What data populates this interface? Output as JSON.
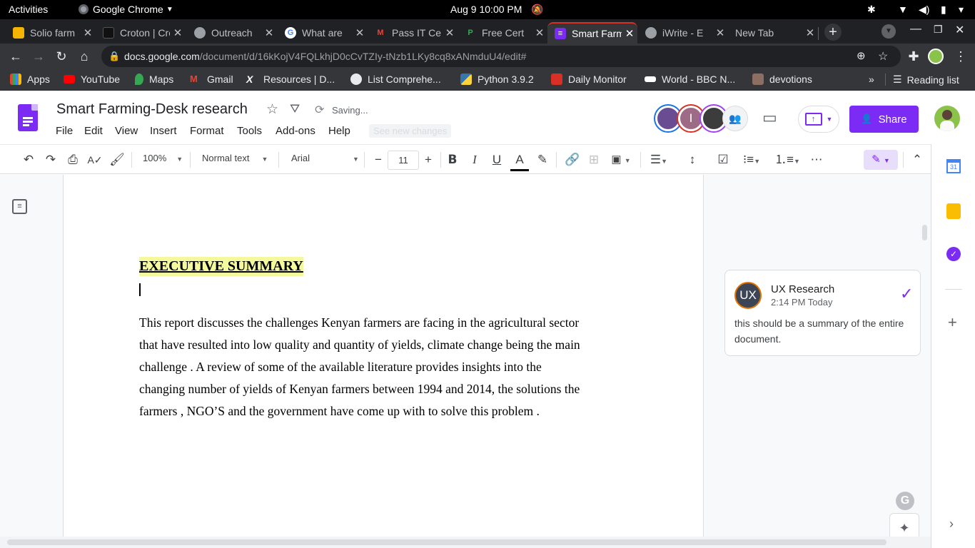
{
  "system_bar": {
    "activities": "Activities",
    "app_name": "Google Chrome",
    "clock": "Aug 9  10:00 PM"
  },
  "tabs": [
    {
      "title": "Solio farm",
      "color": "#f4b400",
      "glyph": "F"
    },
    {
      "title": "Croton | Croton",
      "color": "#111111",
      "glyph": "C"
    },
    {
      "title": "Outreach",
      "color": "#9aa0a6",
      "glyph": ""
    },
    {
      "title": "What are",
      "color": "#4285f4",
      "glyph": "G"
    },
    {
      "title": "Pass IT Ce",
      "color": "#d93025",
      "glyph": "M"
    },
    {
      "title": "Free Cert",
      "color": "#34a853",
      "glyph": "P"
    },
    {
      "title": "Smart Farming",
      "color": "#7b2bf3",
      "glyph": "≡",
      "active": true
    },
    {
      "title": "iWrite - E",
      "color": "#9aa0a6",
      "glyph": ""
    },
    {
      "title": "New Tab",
      "color": "",
      "glyph": ""
    }
  ],
  "omnibox": {
    "host": "docs.google.com",
    "path": "/document/d/16kKojV4FQLkhjD0cCvTZIy-tNzb1LKy8cq8xANmduU4/edit#"
  },
  "bookmarks": [
    {
      "label": "Apps",
      "color": "#ea4335"
    },
    {
      "label": "YouTube",
      "color": "#ff0000"
    },
    {
      "label": "Maps",
      "color": "#34a853"
    },
    {
      "label": "Gmail",
      "color": "#ea4335"
    },
    {
      "label": "Resources | D...",
      "color": "#ffffff"
    },
    {
      "label": "List Comprehe...",
      "color": "#9aa0a6"
    },
    {
      "label": "Python 3.9.2",
      "color": "#3776ab"
    },
    {
      "label": "Daily Monitor",
      "color": "#d93025"
    },
    {
      "label": "World - BBC N...",
      "color": "#000000"
    },
    {
      "label": "devotions",
      "color": "#8d6e63"
    }
  ],
  "reading_list": "Reading list",
  "more_bookmarks": "»",
  "doc": {
    "title": "Smart Farming-Desk research",
    "save_status": "Saving...",
    "see_new_changes": "See new changes",
    "menus": [
      "File",
      "Edit",
      "View",
      "Insert",
      "Format",
      "Tools",
      "Add-ons",
      "Help"
    ],
    "share_label": "Share"
  },
  "toolbar": {
    "zoom": "100%",
    "style": "Normal text",
    "font": "Arial",
    "font_size": "11"
  },
  "content": {
    "heading": "EXECUTIVE SUMMARY",
    "body_lines": [
      "This report discusses the challenges Kenyan farmers are facing in the agricultural sector",
      "that have resulted into low quality and quantity of yields, climate change being the main",
      "challenge . A review of some of the available literature provides insights into the",
      "changing number of yields  of Kenyan farmers between 1994 and 2014,  the solutions the",
      "farmers , NGO’S and the government have come up with to solve this problem ."
    ]
  },
  "comment": {
    "avatar_initials": "UX",
    "author": "UX Research",
    "time": "2:14 PM Today",
    "text": "this should be a summary of the entire document."
  },
  "colors": {
    "accent": "#7b2bf3",
    "highlight": "#f4f99e"
  }
}
